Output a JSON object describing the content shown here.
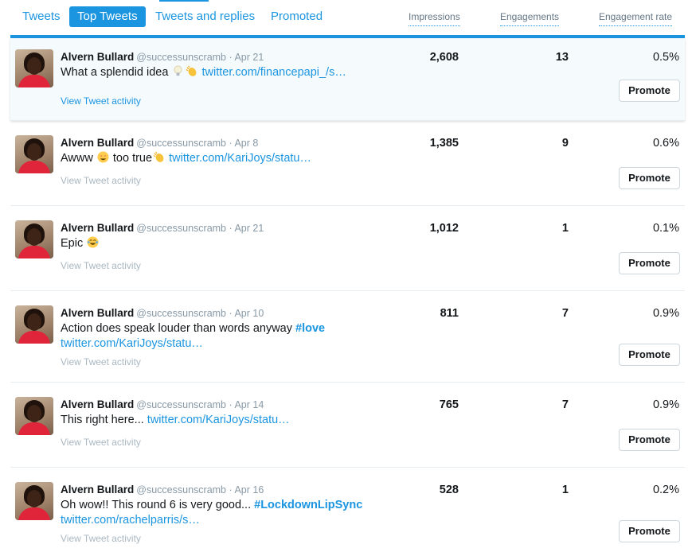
{
  "tabs": [
    {
      "label": "Tweets",
      "active": false
    },
    {
      "label": "Top Tweets",
      "active": true
    },
    {
      "label": "Tweets and replies",
      "active": false
    },
    {
      "label": "Promoted",
      "active": false
    }
  ],
  "columns": {
    "impressions": "Impressions",
    "engagements": "Engagements",
    "engagement_rate": "Engagement rate"
  },
  "accent_color": "#1b95e0",
  "view_activity_label": "View Tweet activity",
  "promote_label": "Promote",
  "tweets": [
    {
      "name": "Alvern Bullard",
      "handle": "@successunscramb",
      "date": "Apr 21",
      "text_before": "What a splendid idea",
      "emoji": [
        "light-bulb-icon",
        "clapping-hands-icon"
      ],
      "text_after": "",
      "link": "twitter.com/financepapi_/s…",
      "hashtag": "",
      "impressions": "2,608",
      "engagements": "13",
      "rate": "0.5%",
      "highlight": true
    },
    {
      "name": "Alvern Bullard",
      "handle": "@successunscramb",
      "date": "Apr 8",
      "text_before": "Awww",
      "emoji": [
        "heart-eyes-icon"
      ],
      "text_after": "too true",
      "emoji_after": [
        "clapping-hands-icon"
      ],
      "link": "twitter.com/KariJoys/statu…",
      "hashtag": "",
      "impressions": "1,385",
      "engagements": "9",
      "rate": "0.6%",
      "highlight": false
    },
    {
      "name": "Alvern Bullard",
      "handle": "@successunscramb",
      "date": "Apr 21",
      "text_before": "Epic",
      "emoji": [
        "tears-of-joy-icon"
      ],
      "text_after": "",
      "link": "",
      "hashtag": "",
      "impressions": "1,012",
      "engagements": "1",
      "rate": "0.1%",
      "highlight": false
    },
    {
      "name": "Alvern Bullard",
      "handle": "@successunscramb",
      "date": "Apr 10",
      "text_before": "Action does speak louder than words anyway",
      "emoji": [],
      "text_after": "",
      "hashtag": "#love",
      "link": "twitter.com/KariJoys/statu…",
      "impressions": "811",
      "engagements": "7",
      "rate": "0.9%",
      "highlight": false
    },
    {
      "name": "Alvern Bullard",
      "handle": "@successunscramb",
      "date": "Apr 14",
      "text_before": "This right here...",
      "emoji": [],
      "text_after": "",
      "link": "twitter.com/KariJoys/statu…",
      "hashtag": "",
      "impressions": "765",
      "engagements": "7",
      "rate": "0.9%",
      "highlight": false
    },
    {
      "name": "Alvern Bullard",
      "handle": "@successunscramb",
      "date": "Apr 16",
      "text_before": "Oh wow!! This round 6 is very good...",
      "emoji": [],
      "text_after": "",
      "hashtag": "#LockdownLipSync",
      "link": "twitter.com/rachelparris/s…",
      "impressions": "528",
      "engagements": "1",
      "rate": "0.2%",
      "highlight": false
    }
  ]
}
